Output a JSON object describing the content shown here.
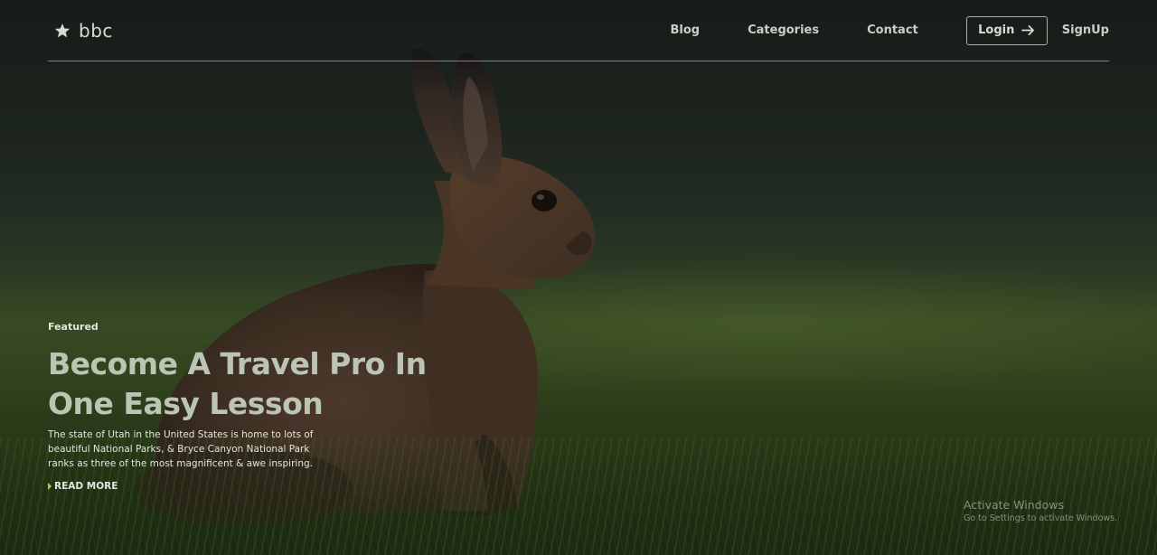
{
  "brand": {
    "name": "bbc",
    "icon": "star-icon"
  },
  "nav": {
    "items": [
      {
        "label": "Blog"
      },
      {
        "label": "Categories"
      },
      {
        "label": "Contact"
      }
    ],
    "login_label": "Login",
    "login_icon": "arrow-right-icon",
    "signup_label": "SignUp"
  },
  "hero": {
    "tag": "Featured",
    "headline_line1": "Become A Travel Pro In",
    "headline_line2": "One Easy Lesson",
    "description": "The state of Utah in the United States is home to lots of beautiful National Parks, & Bryce Canyon National Park ranks as three of the most magnificent & awe inspiring.",
    "read_more_label": "READ MORE"
  },
  "watermark": {
    "title": "Activate Windows",
    "subtitle": "Go to Settings to activate Windows."
  },
  "colors": {
    "headline": "#bcc5b4",
    "accent_caret": "#d8b94a",
    "nav_text": "#c9cfc6"
  }
}
